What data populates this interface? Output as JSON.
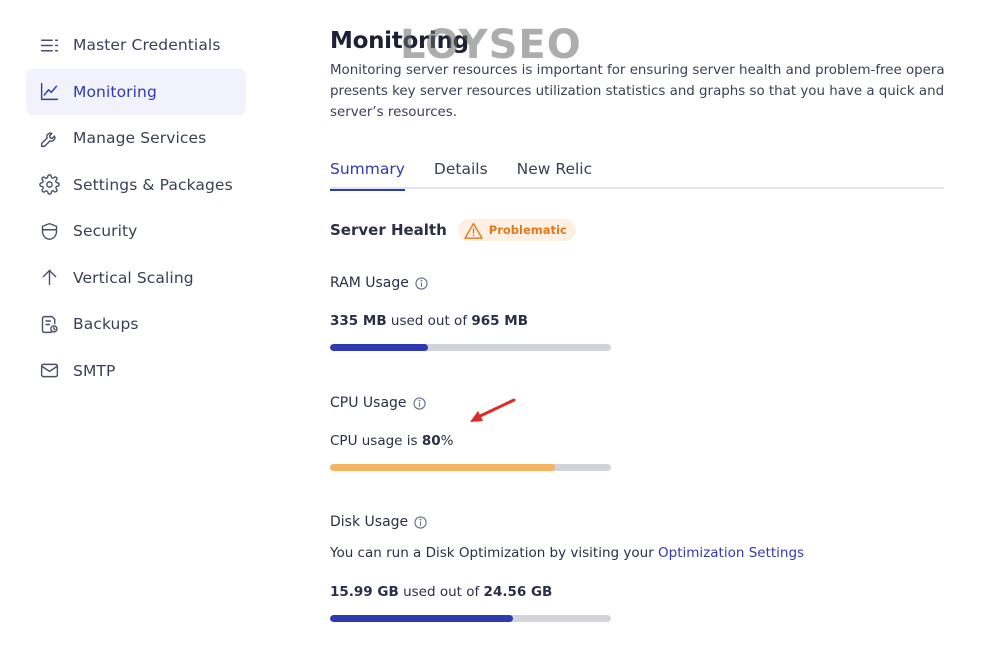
{
  "sidebar": {
    "items": [
      {
        "label": "Master Credentials",
        "icon": "list-icon",
        "active": false
      },
      {
        "label": "Monitoring",
        "icon": "chart-line-icon",
        "active": true
      },
      {
        "label": "Manage Services",
        "icon": "wrench-icon",
        "active": false
      },
      {
        "label": "Settings & Packages",
        "icon": "gear-icon",
        "active": false
      },
      {
        "label": "Security",
        "icon": "shield-icon",
        "active": false
      },
      {
        "label": "Vertical Scaling",
        "icon": "arrow-up-icon",
        "active": false
      },
      {
        "label": "Backups",
        "icon": "backup-document-icon",
        "active": false
      },
      {
        "label": "SMTP",
        "icon": "mail-icon",
        "active": false
      }
    ]
  },
  "main": {
    "title": "Monitoring",
    "description_lines": [
      "Monitoring server resources is important for ensuring server health and problem-free opera",
      "presents key server resources utilization statistics and graphs so that you have a quick and",
      "server’s resources."
    ],
    "tabs": [
      {
        "label": "Summary",
        "active": true
      },
      {
        "label": "Details",
        "active": false
      },
      {
        "label": "New Relic",
        "active": false
      }
    ],
    "server_health": {
      "title": "Server Health",
      "badge": "Problematic"
    },
    "ram": {
      "label": "RAM Usage",
      "used": "335 MB",
      "middle": "used out of",
      "total": "965 MB",
      "fraction": 0.347
    },
    "cpu": {
      "label": "CPU Usage",
      "prefix": "CPU usage is",
      "value": "80",
      "suffix": "%",
      "fraction": 0.8
    },
    "disk": {
      "label": "Disk Usage",
      "note": "You can run a Disk Optimization by visiting your",
      "link": "Optimization Settings",
      "used": "15.99 GB",
      "middle": "used out of",
      "total": "24.56 GB",
      "fraction": 0.651
    }
  },
  "watermark": "LOYSEO",
  "colors": {
    "accent": "#2f3ab2",
    "ram_bar": "#2f3ab2",
    "cpu_bar": "#f5b460",
    "disk_bar": "#2f3ab2",
    "track": "#d2d4da",
    "warning": "#e07a1f",
    "arrow": "#e02a2a"
  }
}
